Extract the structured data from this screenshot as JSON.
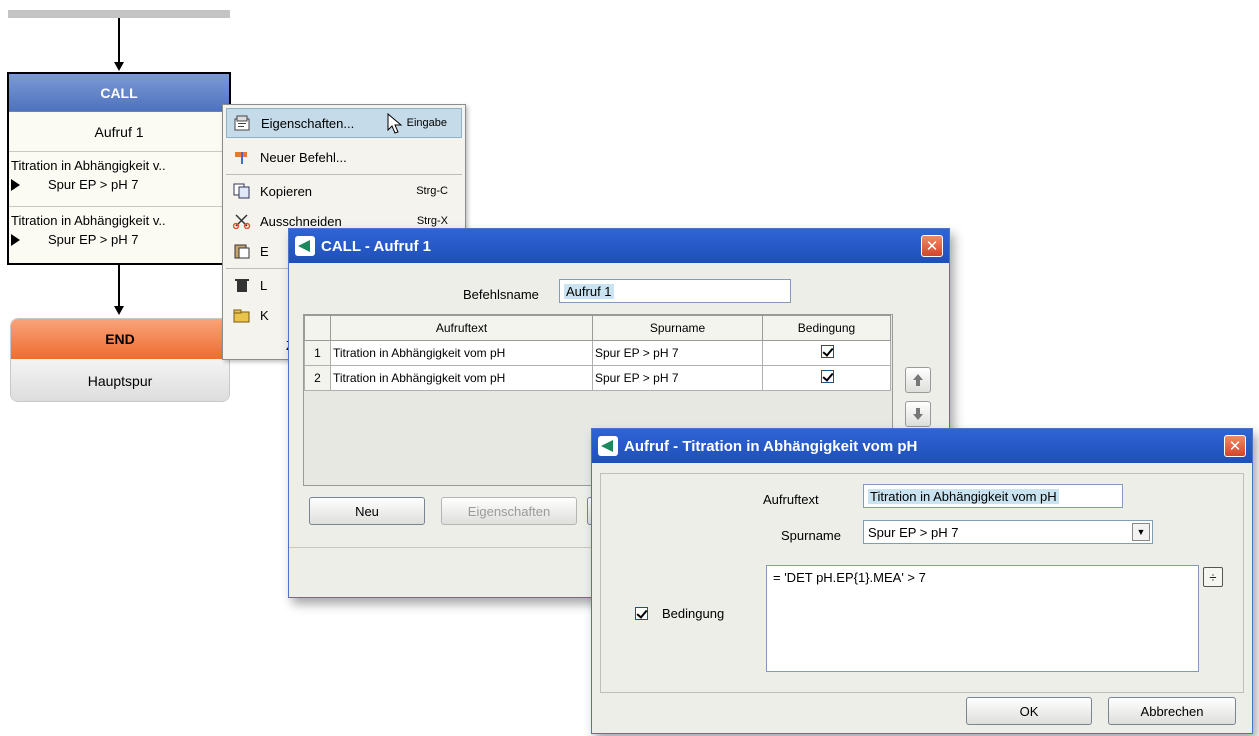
{
  "flow": {
    "call_block": {
      "header": "CALL",
      "name": "Aufruf 1",
      "rows": [
        {
          "text": "Titration in Abhängigkeit v..",
          "track": "Spur EP > pH 7"
        },
        {
          "text": "Titration in Abhängigkeit v..",
          "track": "Spur EP > pH 7"
        }
      ]
    },
    "end_block": {
      "header": "END",
      "track": "Hauptspur"
    }
  },
  "context_menu": {
    "items": [
      {
        "label": "Eigenschaften...",
        "shortcut": "Eingabe",
        "icon": "properties-icon"
      },
      {
        "label": "Neuer Befehl...",
        "shortcut": "",
        "icon": "new-command-icon"
      },
      {
        "label": "Kopieren",
        "shortcut": "Strg-C",
        "icon": "copy-icon"
      },
      {
        "label": "Ausschneiden",
        "shortcut": "Strg-X",
        "icon": "cut-icon"
      },
      {
        "label": "E",
        "shortcut": "",
        "icon": "paste-icon"
      },
      {
        "label": "L",
        "shortcut": "",
        "icon": "delete-icon"
      },
      {
        "label": "K",
        "shortcut": "",
        "icon": "folder-icon"
      },
      {
        "label": "Z",
        "shortcut": "",
        "icon": ""
      }
    ]
  },
  "dialog_call": {
    "title": "CALL - Aufruf 1",
    "close_label": "✕",
    "befehlsname_label": "Befehlsname",
    "befehlsname_value": "Aufruf 1",
    "table": {
      "headers": [
        "Aufruftext",
        "Spurname",
        "Bedingung"
      ],
      "rows": [
        {
          "n": "1",
          "text": "Titration in Abhängigkeit vom pH",
          "track": "Spur EP > pH 7",
          "cond": true
        },
        {
          "n": "2",
          "text": "Titration in Abhängigkeit vom pH",
          "track": "Spur EP > pH 7",
          "cond": true
        }
      ]
    },
    "buttons": {
      "new": "Neu",
      "properties": "Eigenschaften"
    }
  },
  "dialog_aufruf": {
    "title": "Aufruf - Titration in Abhängigkeit vom pH",
    "close_label": "✕",
    "aufruftext_label": "Aufruftext",
    "aufruftext_value": "Titration in Abhängigkeit vom pH",
    "spurname_label": "Spurname",
    "spurname_value": "Spur EP > pH 7",
    "bedingung_label": "Bedingung",
    "bedingung_checked": true,
    "condition_expression": "= 'DET pH.EP{1}.MEA'  >  7",
    "formula_button": "÷",
    "ok": "OK",
    "cancel": "Abbrechen"
  }
}
